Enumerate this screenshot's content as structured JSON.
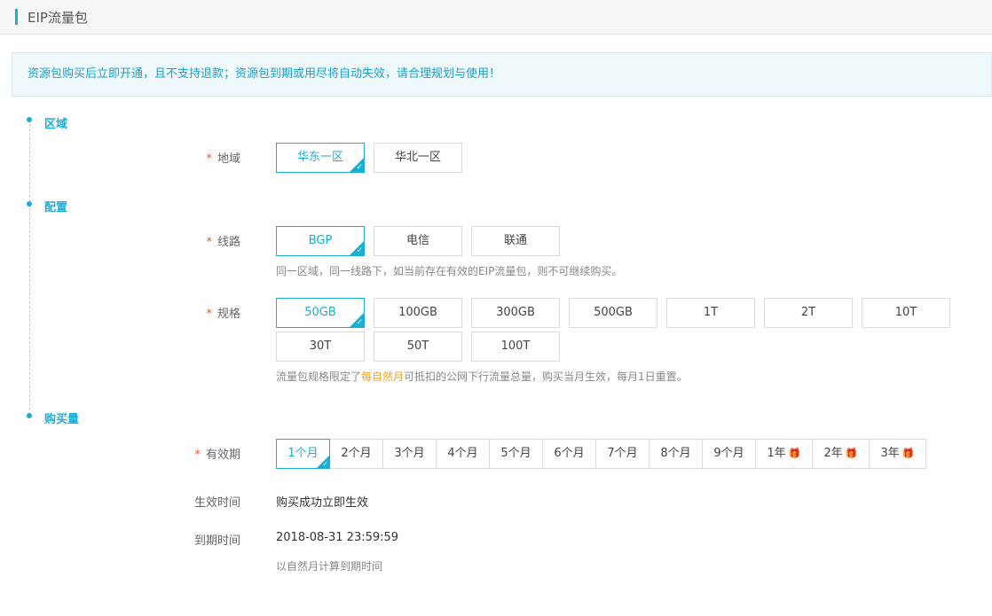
{
  "header": {
    "title": "EIP流量包"
  },
  "notice": {
    "text": "资源包购买后立即开通，且不支持退款；资源包到期或用尽将自动失效，请合理规划与使用！"
  },
  "sections": {
    "region": "区域",
    "config": "配置",
    "purchase": "购买量"
  },
  "required_mark": "*",
  "region": {
    "label": "地域",
    "options": [
      "华东一区",
      "华北一区"
    ],
    "selected": "华东一区"
  },
  "line": {
    "label": "线路",
    "options": [
      "BGP",
      "电信",
      "联通"
    ],
    "selected": "BGP",
    "hint": "同一区域，同一线路下，如当前存在有效的EIP流量包，则不可继续购买。"
  },
  "spec": {
    "label": "规格",
    "options": [
      "50GB",
      "100GB",
      "300GB",
      "500GB",
      "1T",
      "2T",
      "10T",
      "30T",
      "50T",
      "100T"
    ],
    "selected": "50GB",
    "hint_before": "流量包规格限定了",
    "hint_highlight": "每自然月",
    "hint_after": "可抵扣的公网下行流量总量，购买当月生效，每月1日重置。"
  },
  "period": {
    "label": "有效期",
    "options": [
      "1个月",
      "2个月",
      "3个月",
      "4个月",
      "5个月",
      "6个月",
      "7个月",
      "8个月",
      "9个月",
      "1年",
      "2年",
      "3年"
    ],
    "selected": "1个月",
    "gift_icon": "gift-icon"
  },
  "effective": {
    "label": "生效时间",
    "value": "购买成功立即生效"
  },
  "expiry": {
    "label": "到期时间",
    "value": "2018-08-31 23:59:59",
    "hint": "以自然月计算到期时间"
  },
  "colors": {
    "accent": "#19aed6",
    "highlight": "#f0a020",
    "required": "#e4572e",
    "gift": "#e64a3b"
  }
}
